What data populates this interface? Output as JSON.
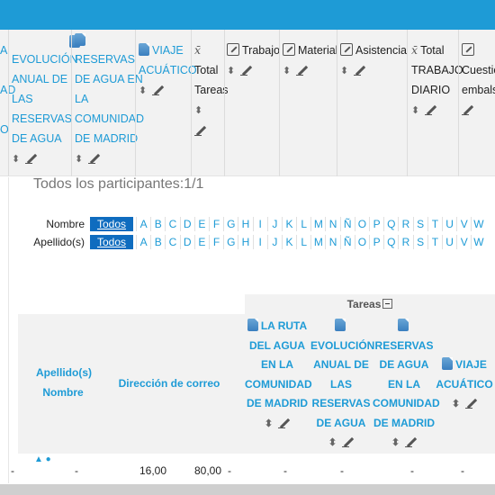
{
  "header_columns": [
    {
      "kind": "doc",
      "lines": [
        "A",
        "",
        "AD",
        "",
        "O"
      ]
    },
    {
      "kind": "doc",
      "lines": [
        "EVOLUCIÓN",
        "ANUAL DE",
        "LAS",
        "RESERVAS",
        "DE AGUA"
      ]
    },
    {
      "kind": "doc",
      "lines": [
        "RESERVAS",
        "DE AGUA EN",
        "LA",
        "COMUNIDAD",
        "DE MADRID"
      ]
    },
    {
      "kind": "doc",
      "lines": [
        "VIAJE",
        "ACUÁTICO"
      ]
    },
    {
      "kind": "fx",
      "lines": [
        "Total",
        "Tareas"
      ]
    },
    {
      "kind": "edit",
      "lines": [
        "Trabajo"
      ]
    },
    {
      "kind": "edit",
      "lines": [
        "Material"
      ]
    },
    {
      "kind": "edit",
      "lines": [
        "Asistencia"
      ]
    },
    {
      "kind": "fx",
      "lines": [
        "Total",
        "TRABAJO",
        "DIARIO"
      ]
    },
    {
      "kind": "edit",
      "lines": [
        "Cuestio",
        "embals"
      ]
    }
  ],
  "participants": "Todos los participantes:1/1",
  "filters": {
    "first_name_label": "Nombre",
    "last_name_label": "Apellido(s)",
    "all_label": "Todos",
    "letters": [
      "A",
      "B",
      "C",
      "D",
      "E",
      "F",
      "G",
      "H",
      "I",
      "J",
      "K",
      "L",
      "M",
      "N",
      "Ñ",
      "O",
      "P",
      "Q",
      "R",
      "S",
      "T",
      "U",
      "V",
      "W"
    ]
  },
  "table": {
    "group_label": "Tareas",
    "col_lastname": "Apellido(s)",
    "col_firstname": "Nombre",
    "col_email": "Dirección de correo",
    "assign_1": [
      "LA RUTA",
      "DEL AGUA",
      "EN LA",
      "COMUNIDAD",
      "DE MADRID"
    ],
    "assign_2": [
      "EVOLUCIÓN",
      "ANUAL DE",
      "LAS",
      "RESERVAS",
      "DE AGUA"
    ],
    "assign_3": [
      "RESERVAS",
      "DE AGUA",
      "EN LA",
      "COMUNIDAD",
      "DE MADRID"
    ],
    "assign_4": [
      "VIAJE",
      "ACUÁTICO"
    ],
    "row": [
      "-",
      "-",
      "16,00",
      "80,00",
      "-",
      "-",
      "-",
      "-",
      "-"
    ]
  },
  "colors": {
    "accent": "#1e9bd6",
    "button": "#0f6cbf"
  }
}
